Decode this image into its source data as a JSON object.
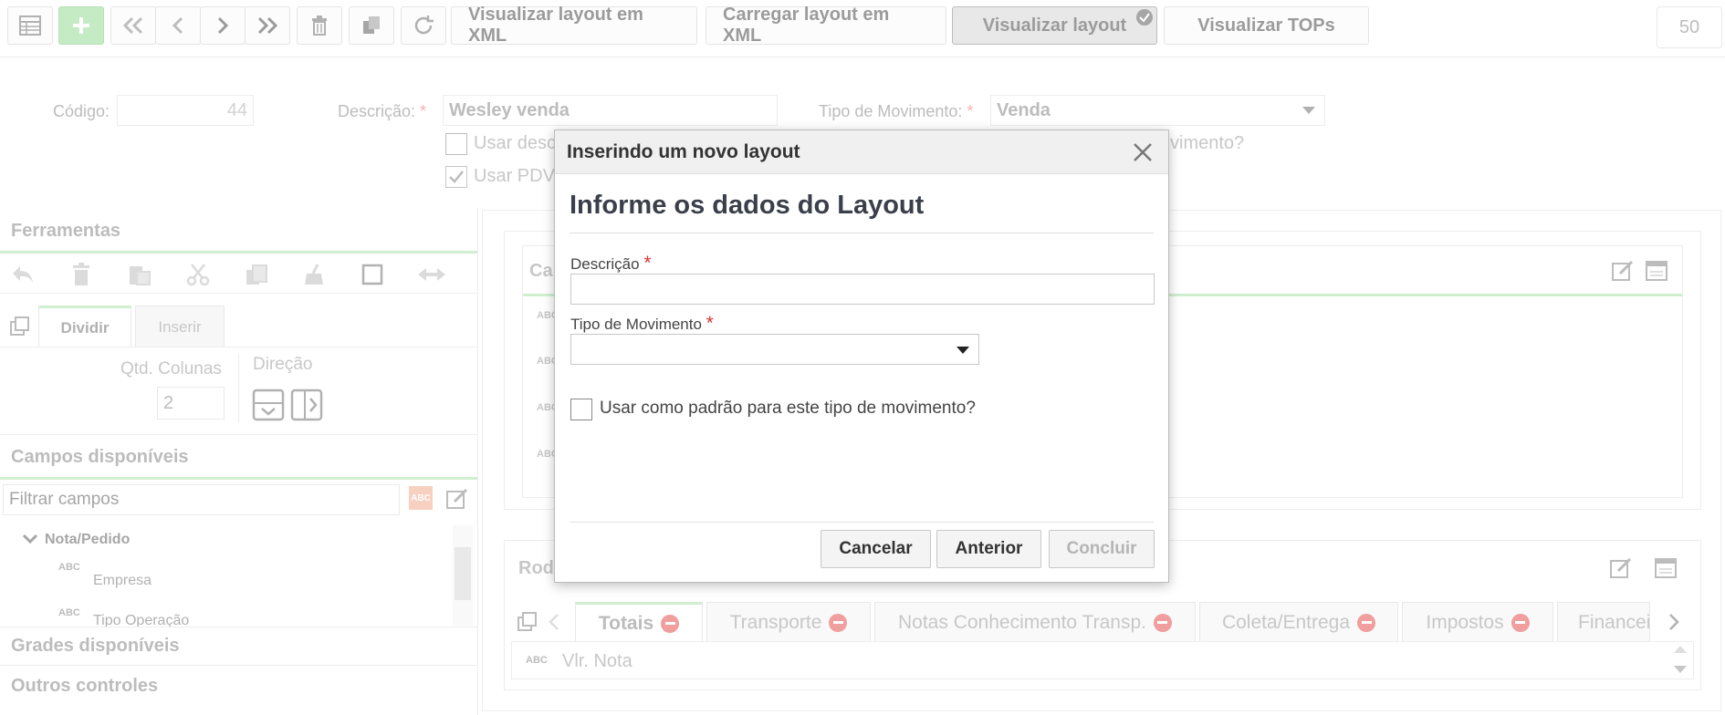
{
  "toolbar": {
    "buttons": [
      "Visualizar layout em XML",
      "Carregar layout em XML",
      "Visualizar layout",
      "Visualizar TOPs"
    ],
    "pager_value": "50"
  },
  "form": {
    "codigo_label": "Código:",
    "codigo_value": "44",
    "descricao_label": "Descrição:",
    "descricao_value": "Wesley venda",
    "tipo_label": "Tipo de Movimento:",
    "tipo_value": "Venda",
    "check1_text": "Usar desc",
    "check1_tail": "vimento?",
    "check2_text": "Usar PDV"
  },
  "left": {
    "ferramentas": "Ferramentas",
    "tabs": [
      "Dividir",
      "Inserir"
    ],
    "qtd_label": "Qtd. Colunas",
    "qtd_value": "2",
    "direcao_label": "Direção",
    "campos_title": "Campos disponíveis",
    "filter_placeholder": "Filtrar campos",
    "tree_root": "Nota/Pedido",
    "tree_items": [
      "Empresa",
      "Tipo Operação"
    ],
    "grades_title": "Grades disponíveis",
    "outros_title": "Outros controles"
  },
  "right": {
    "section1_title": "Ca",
    "section2_title": "Roda",
    "tabs": [
      "Totais",
      "Transporte",
      "Notas Conhecimento Transp.",
      "Coleta/Entrega",
      "Impostos",
      "Financei"
    ],
    "field_label": "Vlr. Nota",
    "abc_label": "ABC"
  },
  "modal": {
    "title": "Inserindo um novo layout",
    "heading": "Informe os dados do Layout",
    "descricao_label": "Descrição",
    "tipo_label": "Tipo de Movimento",
    "checkbox_label": "Usar como padrão para este tipo de movimento?",
    "cancel": "Cancelar",
    "prev": "Anterior",
    "finish": "Concluir"
  },
  "colors": {
    "accent_green": "#a5e0a5",
    "required_red": "#d33333",
    "remove_red": "#e86a6a"
  }
}
